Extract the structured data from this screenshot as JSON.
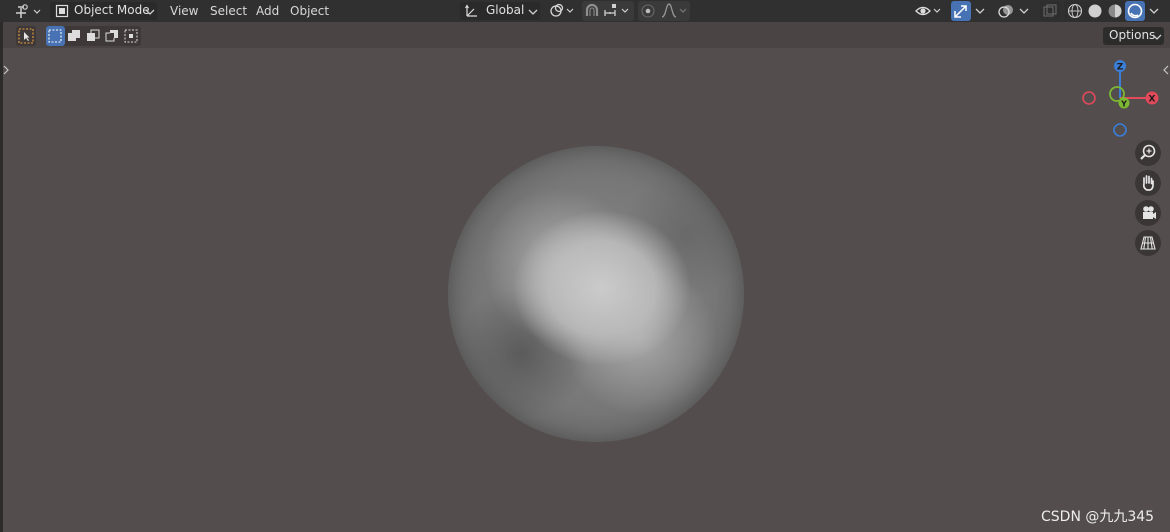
{
  "header": {
    "mode_label": "Object Mode",
    "menus": [
      "View",
      "Select",
      "Add",
      "Object"
    ],
    "orientation_label": "Global"
  },
  "toolbar": {
    "options_label": "Options"
  },
  "gizmo": {
    "x_label": "X",
    "y_label": "Y",
    "z_label": "Z",
    "x_color": "#e04a5a",
    "y_color": "#7cb832",
    "z_color": "#3a7ed8"
  },
  "theme": {
    "accent": "#4772b3",
    "viewport_bg": "#544d4d"
  },
  "watermark": "CSDN @九九345"
}
